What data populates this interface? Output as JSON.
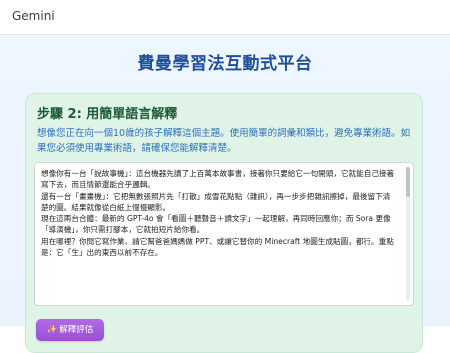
{
  "app": {
    "title": "Gemini"
  },
  "page": {
    "title": "費曼學習法互動式平台"
  },
  "step": {
    "heading": "步驟 2: 用簡單語言解釋",
    "description": "想像您正在向一個10歲的孩子解釋這個主題。使用簡單的詞彙和類比，避免專業術語。如果您必須使用專業術語，請確保您能解釋清楚。"
  },
  "answer": {
    "lines": [
      "想像你有一台「說故事機」：這台機器先讀了上百萬本故事書，接著你只要給它一句開頭，它就能自己接著寫下去，而且情節還能合乎邏輯。",
      "還有一台「畫畫機」：它把無數張照片先「打散」成雪花點點（雜訊），再一步步把雜訊擦掉，最後留下清楚的圖。結果就像從白紙上慢慢顯影。",
      "現在這兩台合體：最新的 GPT-4o 會「看圖＋聽聲音＋讀文字」一起理解，再同時回應你；而 Sora 更像「導演機」，你只需打腳本，它就拍短片給你看。",
      "用在哪裡？你問它寫作業、請它幫爸爸媽媽做 PPT、或讓它替你的 Minecraft 地圖生成貼圖，都行。重點是：它「生」出的東西以前不存在。"
    ]
  },
  "actions": {
    "evaluate_label": "解釋評估",
    "evaluate_icon": "sparkle-icon"
  },
  "colors": {
    "title": "#1f4f9c",
    "heading": "#1d5a37",
    "description": "#2b6fc0",
    "card": "#dff3e6",
    "button": "#9a4fd6"
  }
}
